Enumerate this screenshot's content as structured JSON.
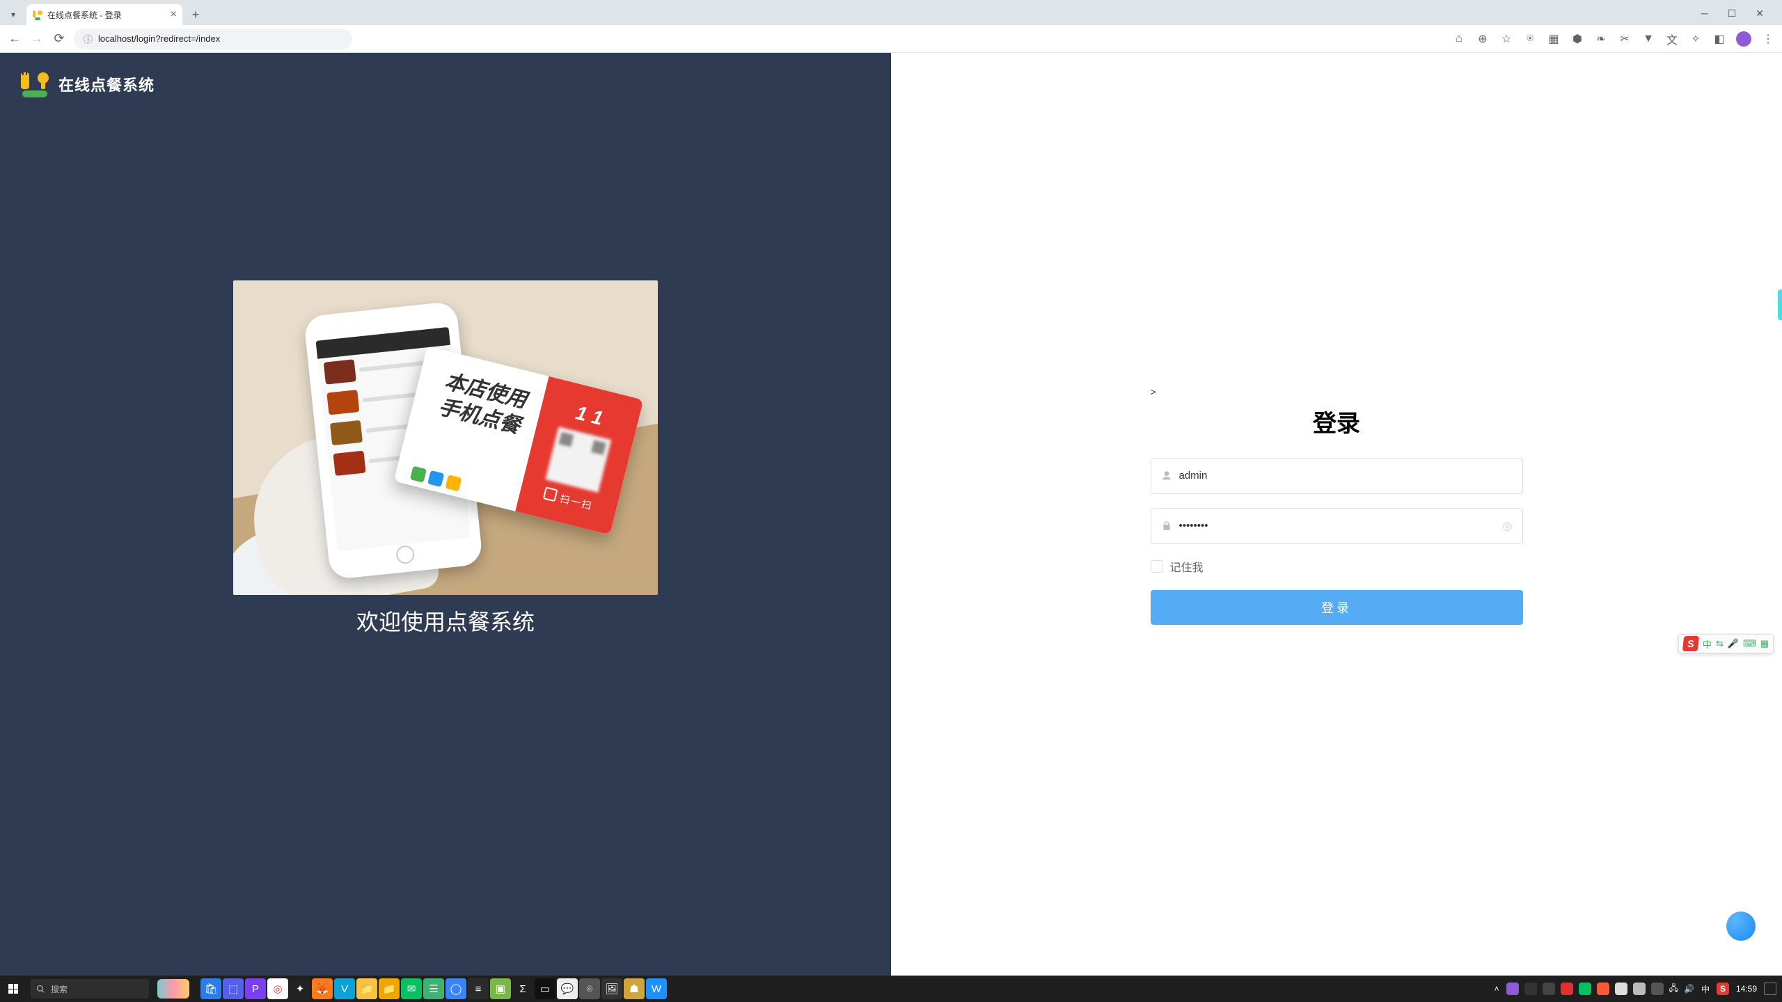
{
  "browser": {
    "tab_title": "在线点餐系统 - 登录",
    "url": "localhost/login?redirect=/index"
  },
  "left_panel": {
    "brand": "在线点餐系统",
    "card_line1": "本店使用",
    "card_line2": "手机点餐",
    "table_number": "1 1",
    "scan_label": "扫一扫",
    "hero_caption": "欢迎使用点餐系统"
  },
  "login": {
    "stray_char": ">",
    "title": "登录",
    "username_value": "admin",
    "password_value": "••••••••",
    "remember_label": "记住我",
    "button_label": "登录"
  },
  "ime": {
    "letter": "S",
    "mode": "中"
  },
  "taskbar": {
    "search_placeholder": "搜索",
    "ime_mode": "中",
    "time": "14:59"
  }
}
